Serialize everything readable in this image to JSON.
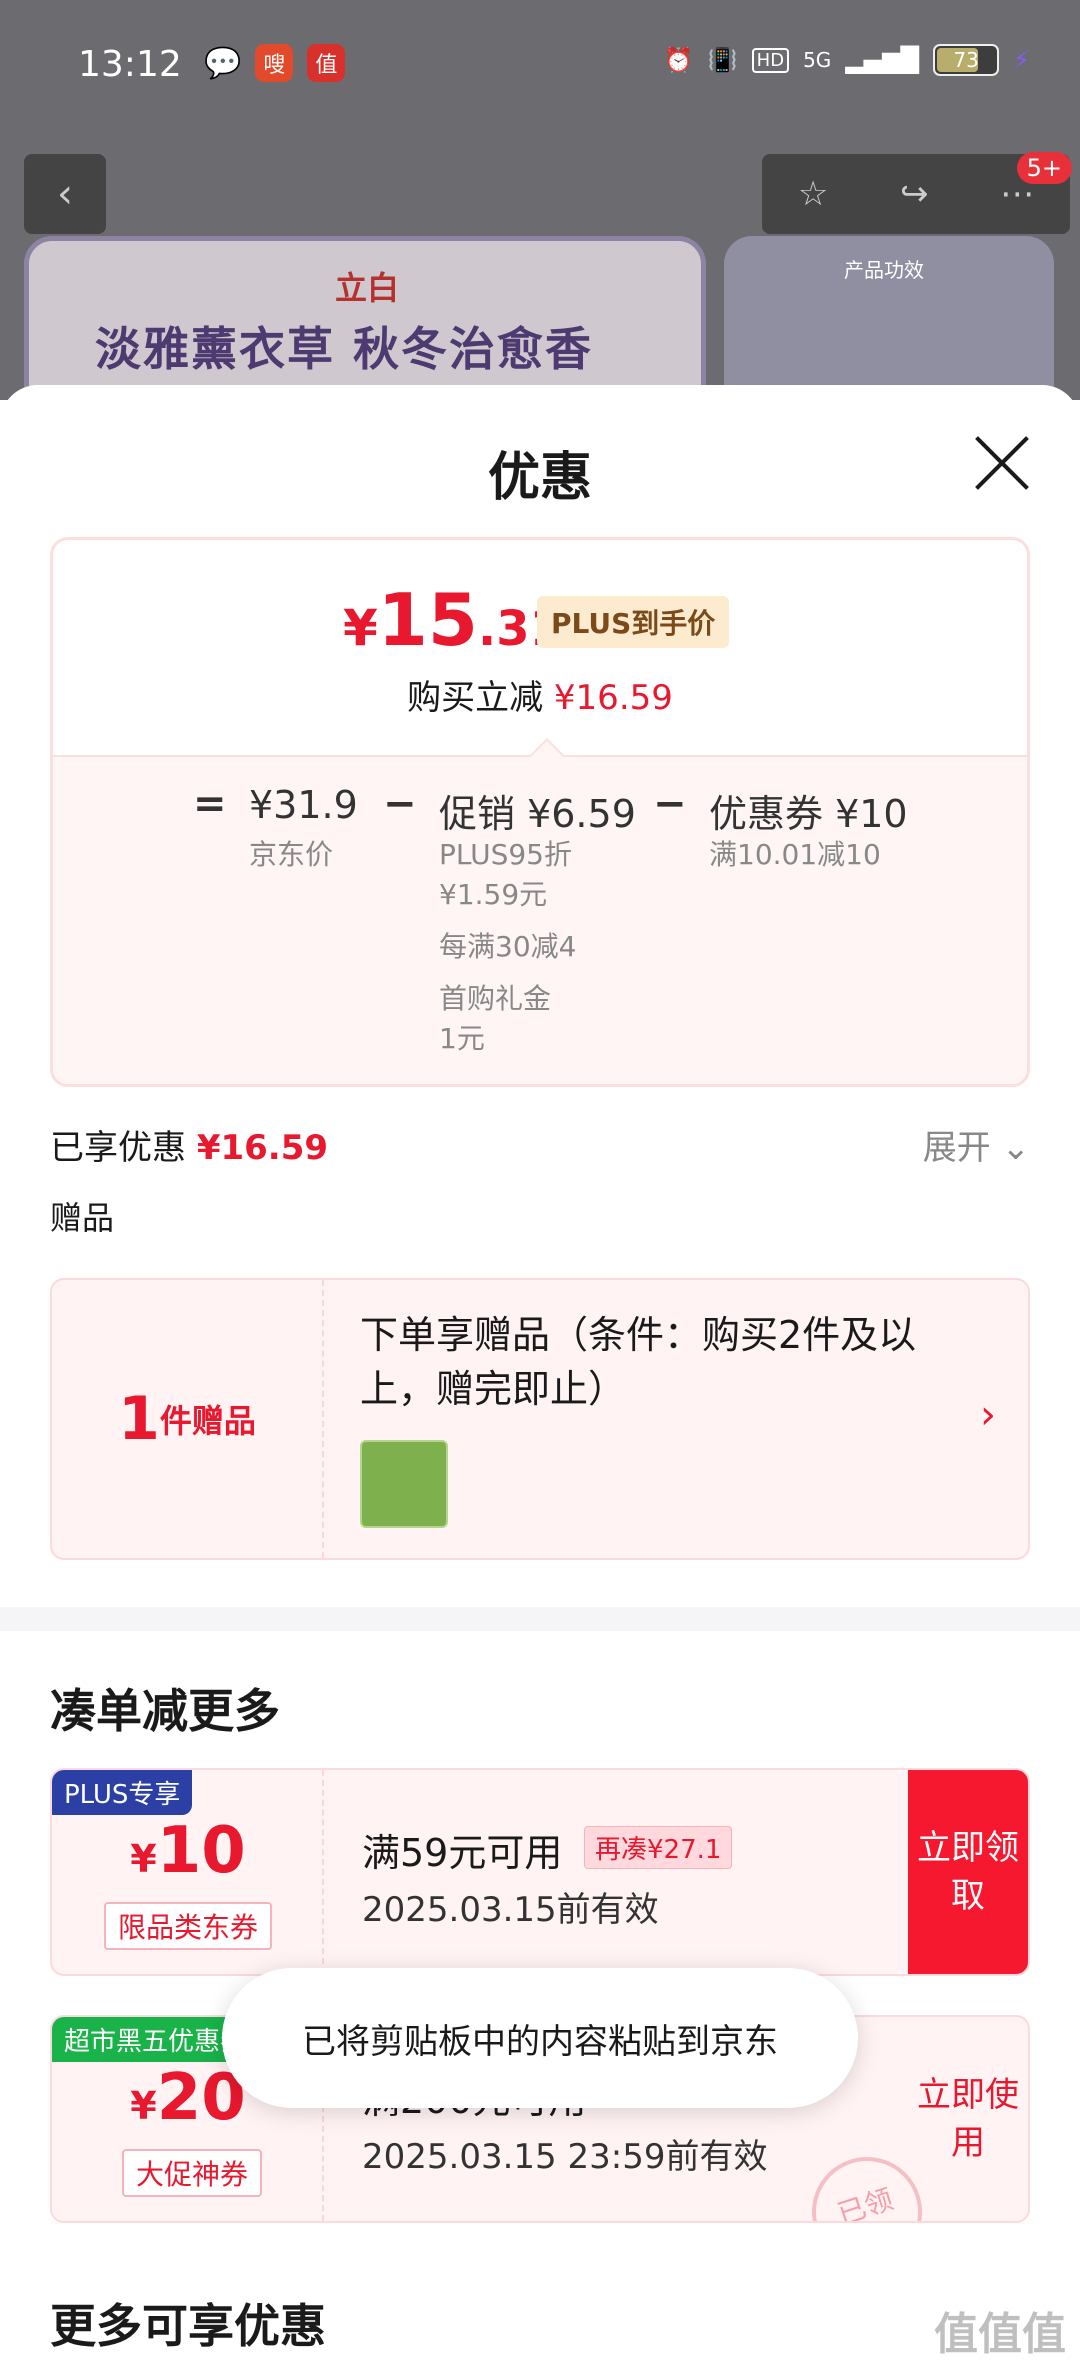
{
  "status": {
    "time": "13:12",
    "app1": "嗖",
    "app2": "值",
    "network": "5G",
    "battery": "73"
  },
  "topbar": {
    "badge": "5+"
  },
  "banner": {
    "logo": "立白",
    "title": "淡雅薰衣草 秋冬治愈香",
    "right_title": "产品功效"
  },
  "sheet": {
    "title": "优惠"
  },
  "price": {
    "yen": "¥",
    "int": "15",
    "dec": ".31",
    "plus_tag": "PLUS到手价",
    "cut_label": "购买立减",
    "cut_value": "¥16.59",
    "eq": "=",
    "minus": "−",
    "jd_value": "¥31.9",
    "jd_label": "京东价",
    "promo_value": "促销 ¥6.59",
    "promo_l1": "PLUS95折",
    "promo_l2": "¥1.59元",
    "promo_l3": "每满30减4",
    "promo_l4": "首购礼金",
    "promo_l5": "1元",
    "coupon_value": "优惠券 ¥10",
    "coupon_label": "满10.01减10"
  },
  "enjoyed": {
    "label": "已享优惠",
    "value": "¥16.59",
    "expand": "展开"
  },
  "gift": {
    "section": "赠品",
    "count": "1",
    "unit": "件赠品",
    "desc": "下单享赠品（条件：购买2件及以上，赠完即止）"
  },
  "more": {
    "title": "凑单减更多"
  },
  "coupons": [
    {
      "tag": "PLUS专享",
      "yen": "¥",
      "amount": "10",
      "kind": "限品类东券",
      "cond": "满59元可用",
      "chip": "再凑¥27.1",
      "expiry": "2025.03.15前有效",
      "action": "立即领取"
    },
    {
      "tag": "超市黑五优惠券",
      "yen": "¥",
      "amount": "20",
      "kind": "大促神券",
      "cond": "满200元可用",
      "chip": "",
      "expiry": "2025.03.15 23:59前有效",
      "action": "立即使用",
      "stamp": "已领"
    }
  ],
  "section2": {
    "title": "更多可享优惠"
  },
  "toast": {
    "text": "已将剪贴板中的内容粘贴到京东"
  },
  "watermark": {
    "text": "值值值"
  }
}
